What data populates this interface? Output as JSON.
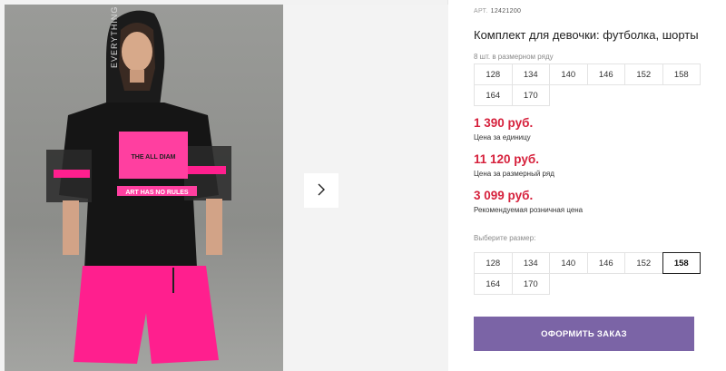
{
  "product": {
    "sku_label": "АРТ.",
    "sku_code": "12421200",
    "title": "Комплект для девочки: футболка, шорты"
  },
  "pack": {
    "label": "8 шт. в размерном ряду",
    "sizes": [
      "128",
      "134",
      "140",
      "146",
      "152",
      "158",
      "164",
      "170"
    ]
  },
  "prices": {
    "unit_price": "1 390 руб.",
    "unit_label": "Цена за единицу",
    "pack_price": "11 120 руб.",
    "pack_label": "Цена за размерный ряд",
    "retail_price": "3 099 руб.",
    "retail_label": "Рекомендуемая розничная цена"
  },
  "size_select": {
    "label": "Выберите размер:",
    "sizes": [
      "128",
      "134",
      "140",
      "146",
      "152",
      "158",
      "164",
      "170"
    ],
    "selected": "158"
  },
  "order_button": "ОФОРМИТЬ ЗАКАЗ",
  "photo_print": {
    "hood_text": "EVERYTHING",
    "shirt_text": "THE ALL DIAM",
    "slogan": "ART HAS NO RULES"
  },
  "colors": {
    "accent_price": "#d6213c",
    "button": "#7b64a6",
    "neon_pink": "#ff1f8e"
  },
  "icons": {
    "next": "chevron-right-icon"
  }
}
